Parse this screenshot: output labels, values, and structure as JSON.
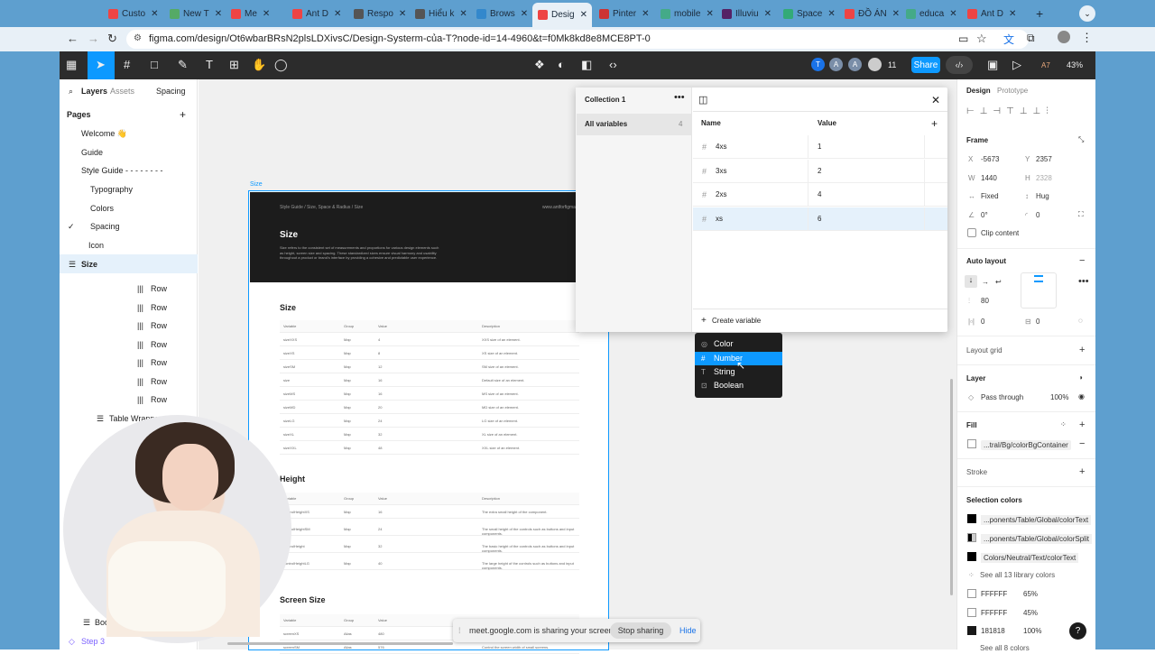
{
  "browser": {
    "tabs": [
      "Custo",
      "New T",
      "Me",
      "Ant D",
      "Respo",
      "Hiểu k",
      "Brows",
      "Desig",
      "Pinter",
      "mobile",
      "Illuviu",
      "Space",
      "ĐỒ ÁN",
      "educa",
      "Ant D"
    ],
    "url": "figma.com/design/Ot6wbarBRsN2plsLDXivsC/Design-Systerm-của-T?node-id=14-4960&t=f0Mk8kd8e8MCE8PT-0"
  },
  "toolbar": {
    "share_label": "Share",
    "zoom": "43%",
    "avatars": [
      "T",
      "A",
      "A"
    ],
    "viewers": "11",
    "version": "A7"
  },
  "left": {
    "tabs": [
      "Layers",
      "Assets"
    ],
    "page_selector": "Spacing",
    "pages_title": "Pages",
    "pages": [
      "Welcome 👋",
      "Guide",
      "Style Guide  - - - - - - - -",
      "Typography",
      "Colors",
      "Spacing",
      "Icon"
    ],
    "selected": "Size",
    "rows": [
      "Row",
      "Row",
      "Row",
      "Row",
      "Row",
      "Row",
      "Row"
    ],
    "table_wrapper": "Table Wrapper",
    "body": "Body",
    "step": "Step 3"
  },
  "canvas": {
    "frame_label": "Size",
    "breadcrumb": "Style Guide  /  Size, Space & Radius  /  Size",
    "site": "www.antforfigma.com",
    "head_title": "Size",
    "head_desc": "Size refers to the consistent set of measurements and proportions for various design elements such as height, screen size and spacing. These standardized sizes ensure visual harmony and usability throughout a product or brand's interface by providing a cohesive and predictable user experience.",
    "sections": [
      "Size",
      "Height",
      "Screen Size"
    ],
    "table_headers": [
      "Variable",
      "Group",
      "Value",
      "Description"
    ],
    "size_rows": [
      [
        "sizeXXS",
        "Map",
        "4",
        "XXS size of an element."
      ],
      [
        "sizeXS",
        "Map",
        "8",
        "XS size of an element."
      ],
      [
        "sizeSM",
        "Map",
        "12",
        "SM size of an element."
      ],
      [
        "size",
        "Map",
        "16",
        "Default size of an element."
      ],
      [
        "sizeMS",
        "Map",
        "16",
        "MS size of an element."
      ],
      [
        "sizeMD",
        "Map",
        "20",
        "MD size of an element."
      ],
      [
        "sizeLG",
        "Map",
        "24",
        "LG size of an element."
      ],
      [
        "sizeXL",
        "Map",
        "32",
        "XL size of an element."
      ],
      [
        "sizeXXL",
        "Map",
        "48",
        "XXL size of an element."
      ]
    ],
    "height_rows": [
      [
        "controlHeightXS",
        "Map",
        "16",
        "The extra small height of the component."
      ],
      [
        "controlHeightSM",
        "Map",
        "24",
        "The small height of the controls such as buttons and input components."
      ],
      [
        "controlHeight",
        "Map",
        "32",
        "The basic height of the controls such as buttons and input components."
      ],
      [
        "controlHeightLG",
        "Map",
        "40",
        "The large height of the controls such as buttons and input components."
      ]
    ],
    "screen_rows": [
      [
        "screenXS",
        "Alias",
        "480",
        "Control the screen width of small screens."
      ],
      [
        "screenSM",
        "Alias",
        "576",
        "Control the screen width of small screens."
      ]
    ]
  },
  "variables": {
    "collection": "Collection 1",
    "all_label": "All variables",
    "all_count": "4",
    "col_name": "Name",
    "col_value": "Value",
    "rows": [
      {
        "name": "4xs",
        "value": "1"
      },
      {
        "name": "3xs",
        "value": "2"
      },
      {
        "name": "2xs",
        "value": "4"
      },
      {
        "name": "xs",
        "value": "6"
      }
    ],
    "create_label": "Create variable",
    "menu": [
      "Color",
      "Number",
      "String",
      "Boolean"
    ]
  },
  "right": {
    "tabs": [
      "Design",
      "Prototype"
    ],
    "frame_title": "Frame",
    "x": "-5673",
    "y": "2357",
    "w": "1440",
    "h": "2328",
    "fixed": "Fixed",
    "hug": "Hug",
    "rotation": "0°",
    "radius": "0",
    "clip": "Clip content",
    "auto_layout": "Auto layout",
    "gap": "80",
    "pad_h": "0",
    "pad_v": "0",
    "layout_grid": "Layout grid",
    "layer": "Layer",
    "blend": "Pass through",
    "opacity": "100%",
    "fill": "Fill",
    "fill_value": "...tral/Bg/colorBgContainer",
    "stroke": "Stroke",
    "selection_colors": "Selection colors",
    "sel": [
      "...ponents/Table/Global/colorText",
      "...ponents/Table/Global/colorSplit",
      "Colors/Neutral/Text/colorText"
    ],
    "see_all_lib": "See all 13 library colors",
    "hex": [
      {
        "hex": "FFFFFF",
        "pct": "65%"
      },
      {
        "hex": "FFFFFF",
        "pct": "45%"
      },
      {
        "hex": "181818",
        "pct": "100%"
      }
    ],
    "see_all": "See all 8 colors"
  },
  "share_bar": {
    "text": "meet.google.com is sharing your screen.",
    "stop": "Stop sharing",
    "hide": "Hide"
  },
  "colors": {
    "accent": "#0d99ff",
    "dark": "#2c2c2c",
    "chrome": "#5e9fcf"
  }
}
